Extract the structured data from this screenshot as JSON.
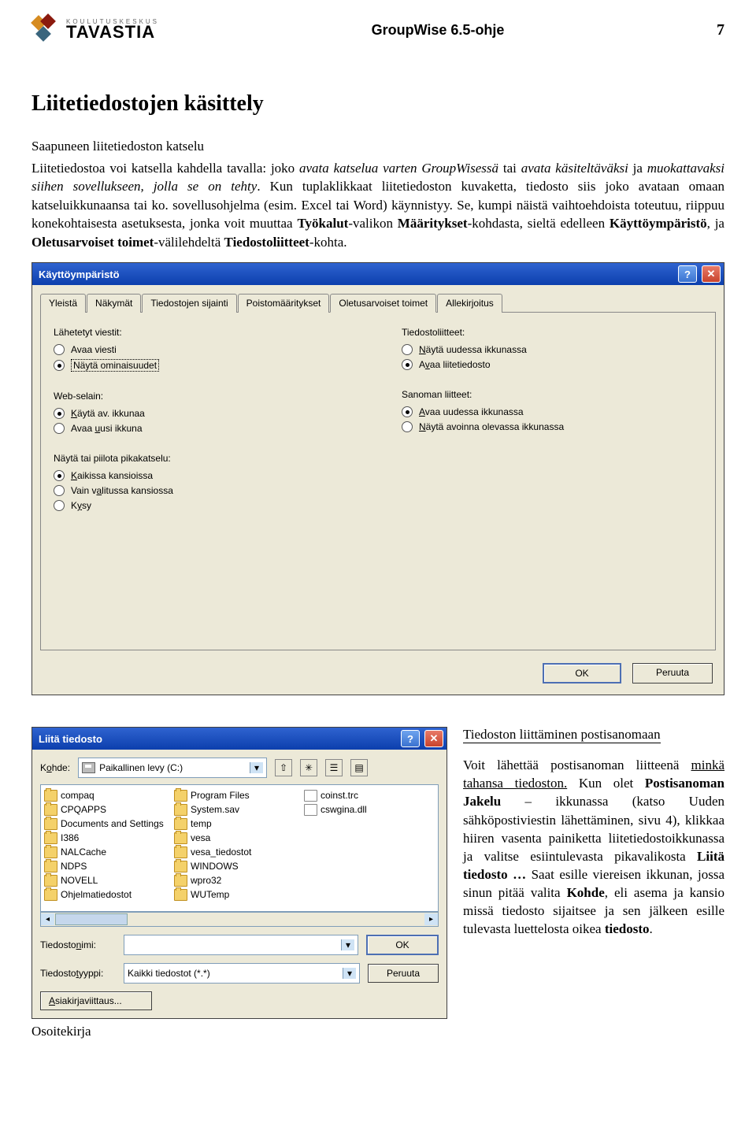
{
  "header": {
    "logo_small": "KOULUTUSKESKUS",
    "logo_big": "TAVASTIA",
    "doc_title": "GroupWise 6.5-ohje",
    "page": "7"
  },
  "h1": "Liitetiedostojen käsittely",
  "sec1_title": "Saapuneen liitetiedoston katselu",
  "para1_a": "Liitetiedostoa voi katsella kahdella tavalla: joko ",
  "para1_b": "avata katselua varten GroupWisessä",
  "para1_c": " tai ",
  "para1_d": "avata käsiteltäväksi",
  "para1_e": " ja ",
  "para1_f": "muokattavaksi siihen sovellukseen, jolla se on tehty",
  "para1_g": ". Kun tuplaklikkaat liitetiedoston kuvaketta, tiedosto siis joko avataan omaan katseluikkunaansa tai ko. sovellusohjelma (esim. Excel tai Word) käynnistyy. Se, kumpi näistä vaihtoehdoista toteutuu, riippuu konekohtaisesta asetuksesta, jonka voit muuttaa ",
  "para1_h": "Työkalut",
  "para1_i": "-valikon ",
  "para1_j": "Määritykset",
  "para1_k": "-kohdasta, sieltä edelleen ",
  "para1_l": "Käyttöympäristö",
  "para1_m": ", ja ",
  "para1_n": "Oletusarvoiset toimet",
  "para1_o": "-välilehdeltä ",
  "para1_p": "Tiedostoliitteet",
  "para1_q": "-kohta.",
  "dlg1": {
    "title": "Käyttöympäristö",
    "tabs": [
      "Yleistä",
      "Näkymät",
      "Tiedostojen sijainti",
      "Poistomääritykset",
      "Oletusarvoiset toimet",
      "Allekirjoitus"
    ],
    "left": {
      "g1": {
        "label": "Lähetetyt viestit:",
        "r1": "Avaa viesti",
        "r2": "Näytä ominaisuudet"
      },
      "g2": {
        "label": "Web-selain:",
        "r1": "Käytä av. ikkunaa",
        "r2": "Avaa uusi ikkuna"
      },
      "g3": {
        "label": "Näytä tai piilota pikakatselu:",
        "r1": "Kaikissa kansioissa",
        "r2": "Vain valitussa kansiossa",
        "r3": "Kysy"
      }
    },
    "right": {
      "g1": {
        "label": "Tiedostoliitteet:",
        "r1": "Näytä uudessa ikkunassa",
        "r2": "Avaa liitetiedosto"
      },
      "g2": {
        "label": "Sanoman liitteet:",
        "r1": "Avaa uudessa ikkunassa",
        "r2": "Näytä avoinna olevassa ikkunassa"
      }
    },
    "ok": "OK",
    "cancel": "Peruuta"
  },
  "dlg2": {
    "title": "Liitä tiedosto",
    "kohde_label": "Kohde:",
    "kohde_value": "Paikallinen levy (C:)",
    "files": [
      {
        "n": "compaq",
        "t": "f"
      },
      {
        "n": "CPQAPPS",
        "t": "f"
      },
      {
        "n": "Documents and Settings",
        "t": "f"
      },
      {
        "n": "I386",
        "t": "f"
      },
      {
        "n": "NALCache",
        "t": "f"
      },
      {
        "n": "NDPS",
        "t": "f"
      },
      {
        "n": "NOVELL",
        "t": "f"
      },
      {
        "n": "Ohjelmatiedostot",
        "t": "f"
      },
      {
        "n": "Program Files",
        "t": "f"
      },
      {
        "n": "System.sav",
        "t": "f"
      },
      {
        "n": "temp",
        "t": "f"
      },
      {
        "n": "vesa",
        "t": "f"
      },
      {
        "n": "vesa_tiedostot",
        "t": "f"
      },
      {
        "n": "WINDOWS",
        "t": "f"
      },
      {
        "n": "wpro32",
        "t": "f"
      },
      {
        "n": "WUTemp",
        "t": "f"
      },
      {
        "n": "coinst.trc",
        "t": "file"
      },
      {
        "n": "cswgina.dll",
        "t": "file"
      }
    ],
    "fname_label": "Tiedostonimi:",
    "fname_value": "",
    "ftype_label": "Tiedostotyyppi:",
    "ftype_value": "Kaikki tiedostot (*.*)",
    "ok": "OK",
    "cancel": "Peruuta",
    "asiak": "Asiakirjaviittaus..."
  },
  "side": {
    "h": "Tiedoston liittäminen postisanomaan",
    "p_a": "Voit lähettää postisanoman liitteenä ",
    "p_b": "minkä tahansa tiedoston.",
    "p_c": " Kun olet ",
    "p_d": "Postisanoman Jakelu",
    "p_e": " – ikkunassa (katso Uuden sähköpostiviestin lähettäminen, sivu 4), klikkaa hiiren vasenta painiketta liitetiedostoikkunassa ja valitse esiintulevasta pikavalikosta ",
    "p_f": "Liitä tiedosto …",
    "p_g": " Saat esille viereisen ikkunan, jossa sinun pitää valita ",
    "p_h": "Kohde",
    "p_i": ", eli asema ja kansio missä tiedosto sijaitsee ja sen jälkeen esille tulevasta luettelosta oikea ",
    "p_j": "tiedosto",
    "p_k": "."
  },
  "osoitekirja": "Osoitekirja"
}
